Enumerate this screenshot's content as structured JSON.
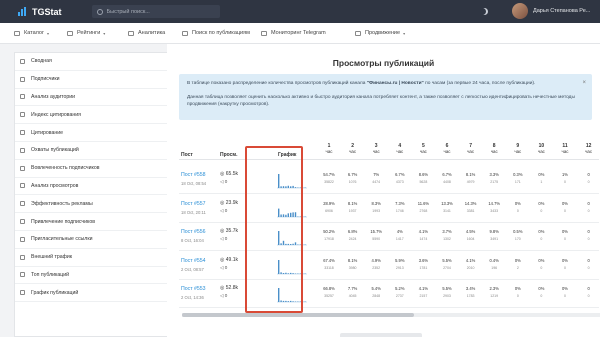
{
  "app": {
    "logo_text": "TGStat",
    "search_placeholder": "Быстрый поиск...",
    "user_name": "Дарья Степанова Ре..."
  },
  "nav": [
    {
      "label": "Каталог",
      "caret": "▾",
      "icon": "list-icon"
    },
    {
      "label": "Рейтинги",
      "caret": "▾",
      "icon": "bars-icon"
    },
    {
      "label": "Аналитика",
      "icon": "chart-icon"
    },
    {
      "label": "Поиск по публикациям",
      "icon": "search-icon"
    },
    {
      "label": "Мониторинг Telegram",
      "icon": "monitor-icon"
    },
    {
      "label": "Продвижение",
      "caret": "▾",
      "icon": "megaphone-icon"
    }
  ],
  "sidebar": [
    {
      "label": "Сводная"
    },
    {
      "label": "Подписчики"
    },
    {
      "label": "Анализ аудитории"
    },
    {
      "label": "Индекс цитирования"
    },
    {
      "label": "Цитирование"
    },
    {
      "label": "Охваты публикаций"
    },
    {
      "label": "Вовлеченность подписчиков"
    },
    {
      "label": "Анализ просмотров",
      "active": true
    },
    {
      "label": "Эффективность рекламы"
    },
    {
      "label": "Привлечение подписчиков"
    },
    {
      "label": "Пригласительные ссылки"
    },
    {
      "label": "Внешний трафик"
    },
    {
      "label": "Топ публикаций"
    },
    {
      "label": "График публикаций"
    }
  ],
  "page": {
    "title": "Просмотры публикаций",
    "info_1_a": "В таблице показано распределение количества просмотров публикаций канала ",
    "info_1_channel": "\"Финансы.ru | Новости\"",
    "info_1_b": " по часам (за первые 24 часа, после публикации).",
    "info_2": "Данная таблица позволяет оценить насколько активно и быстро аудитория канала потребляет контент, а также позволяет с легкостью идентифицировать нечестные методы продвижения (накрутку просмотров).",
    "close": "×"
  },
  "table": {
    "col_post": "Пост",
    "col_views": "Просм.",
    "col_graph": "График",
    "hour_unit": "час",
    "hours": [
      "1",
      "2",
      "3",
      "4",
      "5",
      "6",
      "7",
      "8",
      "9",
      "10",
      "11",
      "12"
    ],
    "rows": [
      {
        "post": "Пост #558",
        "date": "18 Oct, 08:54",
        "views": "◎ 65.5k",
        "shares": "◁ 0",
        "pct": [
          "54.7%",
          "6.7%",
          "7%",
          "6.7%",
          "8.6%",
          "6.7%",
          "8.1%",
          "3.3%",
          "0.3%",
          "0%",
          "1%",
          "0"
        ],
        "cnt": [
          "35822",
          "1076",
          "4474",
          "4373",
          "5628",
          "4408",
          "4979",
          "2175",
          "171",
          "1",
          "0",
          "0"
        ],
        "graph": [
          100,
          12,
          13,
          12,
          16,
          12,
          15,
          6,
          1,
          0,
          0,
          0
        ]
      },
      {
        "post": "Пост #557",
        "date": "18 Oct, 20:11",
        "views": "◎ 23.9k",
        "shares": "◁ 0",
        "pct": [
          "28.9%",
          "8.1%",
          "8.3%",
          "7.3%",
          "11.6%",
          "13.3%",
          "14.3%",
          "14.7%",
          "0%",
          "0%",
          "0%",
          "0"
        ],
        "cnt": [
          "6906",
          "1937",
          "1993",
          "1746",
          "2768",
          "3141",
          "3381",
          "3433",
          "0",
          "0",
          "0",
          "0"
        ],
        "graph": [
          60,
          18,
          19,
          16,
          26,
          30,
          33,
          34,
          0,
          0,
          0,
          0
        ]
      },
      {
        "post": "Пост #556",
        "date": "8 Oct, 16:04",
        "views": "◎ 35.7k",
        "shares": "◁ 0",
        "pct": [
          "50.2%",
          "6.8%",
          "15.7%",
          "4%",
          "4.1%",
          "3.7%",
          "4.5%",
          "9.8%",
          "0.5%",
          "0%",
          "0%",
          "0"
        ],
        "cnt": [
          "17918",
          "2424",
          "5590",
          "1417",
          "1474",
          "1302",
          "1604",
          "3491",
          "170",
          "0",
          "0",
          "0"
        ],
        "graph": [
          100,
          12,
          30,
          8,
          8,
          7,
          9,
          19,
          1,
          0,
          0,
          0
        ]
      },
      {
        "post": "Пост #554",
        "date": "2 Oct, 08:57",
        "views": "◎ 49.1k",
        "shares": "◁ 0",
        "pct": [
          "67.4%",
          "8.1%",
          "4.9%",
          "5.9%",
          "3.6%",
          "5.5%",
          "4.1%",
          "0.4%",
          "0%",
          "0%",
          "0%",
          "0"
        ],
        "cnt": [
          "33118",
          "3980",
          "2352",
          "2913",
          "1781",
          "2704",
          "2010",
          "196",
          "2",
          "0",
          "0",
          "0"
        ],
        "graph": [
          100,
          12,
          7,
          9,
          5,
          8,
          6,
          1,
          0,
          0,
          0,
          0
        ]
      },
      {
        "post": "Пост #553",
        "date": "2 Oct, 14:36",
        "views": "◎ 52.8k",
        "shares": "◁ 0",
        "pct": [
          "66.8%",
          "7.7%",
          "5.4%",
          "5.2%",
          "4.1%",
          "5.5%",
          "3.4%",
          "2.3%",
          "0%",
          "0%",
          "0%",
          "0"
        ],
        "cnt": [
          "35257",
          "4045",
          "2848",
          "2737",
          "2157",
          "2903",
          "1783",
          "1219",
          "0",
          "0",
          "0",
          "0"
        ],
        "graph": [
          100,
          11,
          8,
          8,
          6,
          8,
          5,
          3,
          0,
          0,
          0,
          0
        ]
      }
    ]
  },
  "colors": {
    "accent": "#3fa9f5",
    "highlight": "#d94a36",
    "topbar": "#2f3542",
    "link": "#2b8fd6"
  }
}
